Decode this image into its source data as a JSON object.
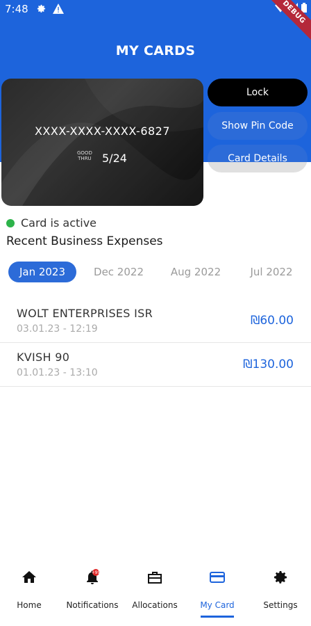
{
  "status_bar": {
    "time": "7:48"
  },
  "debug_ribbon": "DEBUG",
  "page_title": "MY CARDS",
  "card": {
    "number": "XXXX-XXXX-XXXX-6827",
    "good_thru_line1": "GOOD",
    "good_thru_line2": "THRU",
    "expiry": "5/24"
  },
  "actions": {
    "lock": "Lock",
    "show_pin": "Show Pin Code",
    "card_details": "Card Details"
  },
  "card_status": {
    "label": "Card is active",
    "color": "#2db34a"
  },
  "section_title": "Recent Business Expenses",
  "months": [
    {
      "label": "Jan 2023",
      "active": true
    },
    {
      "label": "Dec 2022",
      "active": false
    },
    {
      "label": "Aug 2022",
      "active": false
    },
    {
      "label": "Jul 2022",
      "active": false
    }
  ],
  "transactions": [
    {
      "merchant": "WOLT ENTERPRISES ISR",
      "datetime": "03.01.23 - 12:19",
      "amount": "₪60.00"
    },
    {
      "merchant": "KVISH 90",
      "datetime": "01.01.23 - 13:10",
      "amount": "₪130.00"
    }
  ],
  "bottom_nav": [
    {
      "label": "Home",
      "icon": "home-icon"
    },
    {
      "label": "Notifications",
      "icon": "bell-icon",
      "badge": "+99"
    },
    {
      "label": "Allocations",
      "icon": "briefcase-icon"
    },
    {
      "label": "My Card",
      "icon": "credit-card-icon",
      "active": true
    },
    {
      "label": "Settings",
      "icon": "gear-icon"
    }
  ],
  "colors": {
    "primary": "#1d64dc",
    "active_dot": "#2db34a",
    "debug": "#b4283a"
  }
}
